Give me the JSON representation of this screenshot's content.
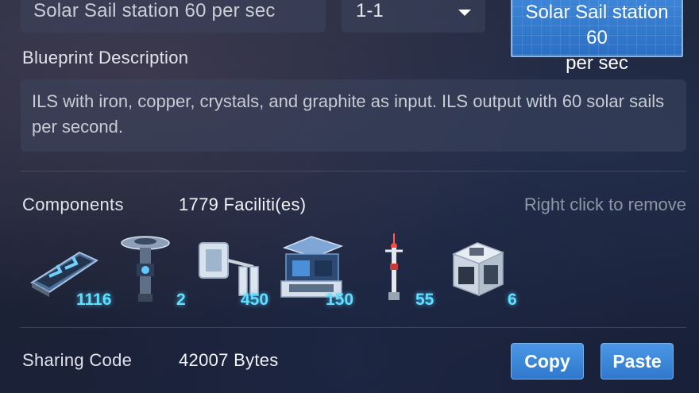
{
  "blueprint": {
    "name_value": "Solar Sail station 60 per sec",
    "layer_value": "1-1",
    "button_line1": "Solar Sail station 60",
    "button_line2": "per sec",
    "description_label": "Blueprint  Description",
    "description_text": "ILS with iron, copper, crystals, and graphite as input. ILS output with 60 solar sails per second."
  },
  "components": {
    "label": "Components",
    "total": "1779 Faciliti(es)",
    "hint": "Right click to remove",
    "items": [
      {
        "icon": "conveyor-belt-icon",
        "count": "1116"
      },
      {
        "icon": "interstellar-logistics-station-icon",
        "count": "2"
      },
      {
        "icon": "sorter-icon",
        "count": "450"
      },
      {
        "icon": "assembler-icon",
        "count": "150"
      },
      {
        "icon": "tesla-tower-icon",
        "count": "55"
      },
      {
        "icon": "storage-box-icon",
        "count": "6"
      }
    ]
  },
  "sharing": {
    "label": "Sharing  Code",
    "size": "42007 Bytes",
    "copy_label": "Copy",
    "paste_label": "Paste"
  }
}
